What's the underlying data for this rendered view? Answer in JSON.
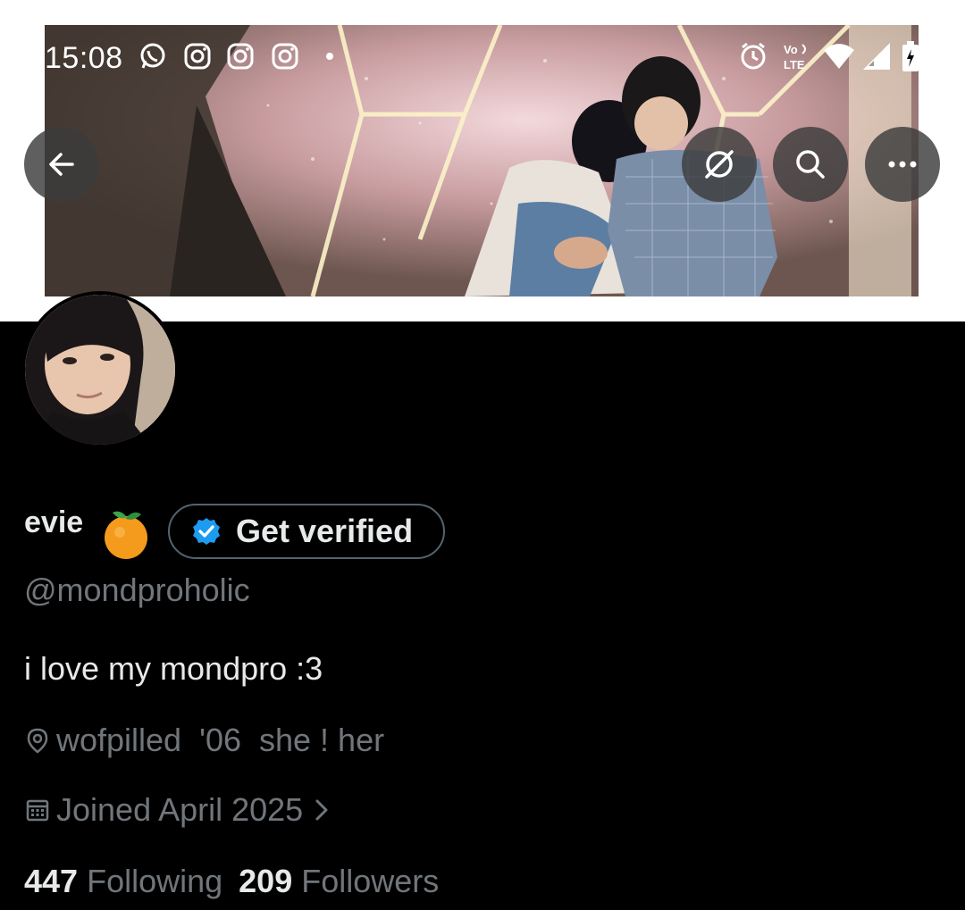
{
  "status_bar": {
    "time": "15:08",
    "left_icons": [
      "whatsapp-icon",
      "instagram-icon",
      "instagram-icon",
      "instagram-icon",
      "dot-icon"
    ],
    "right_icons": [
      "alarm-icon",
      "volte-icon",
      "wifi-icon",
      "signal-icon",
      "battery-icon"
    ],
    "volte_text": "Vo LTE"
  },
  "banner": {
    "nav_icons": [
      "back-arrow-icon",
      "mute-icon",
      "search-icon",
      "more-icon"
    ]
  },
  "profile": {
    "display_name": "evie",
    "name_emoji": "🍊",
    "verify_label": "Get verified",
    "handle": "@mondproholic",
    "bio": "i love my mondpro :3",
    "location": "wofpilled  '06  she ! her",
    "joined": "Joined April 2025",
    "following_count": "447",
    "following_label": "Following",
    "followers_count": "209",
    "followers_label": "Followers"
  },
  "colors": {
    "background": "#000000",
    "primary_text": "#e7e9ea",
    "secondary_text": "#71767b",
    "verified_blue": "#1d9bf0",
    "border": "#536471"
  }
}
